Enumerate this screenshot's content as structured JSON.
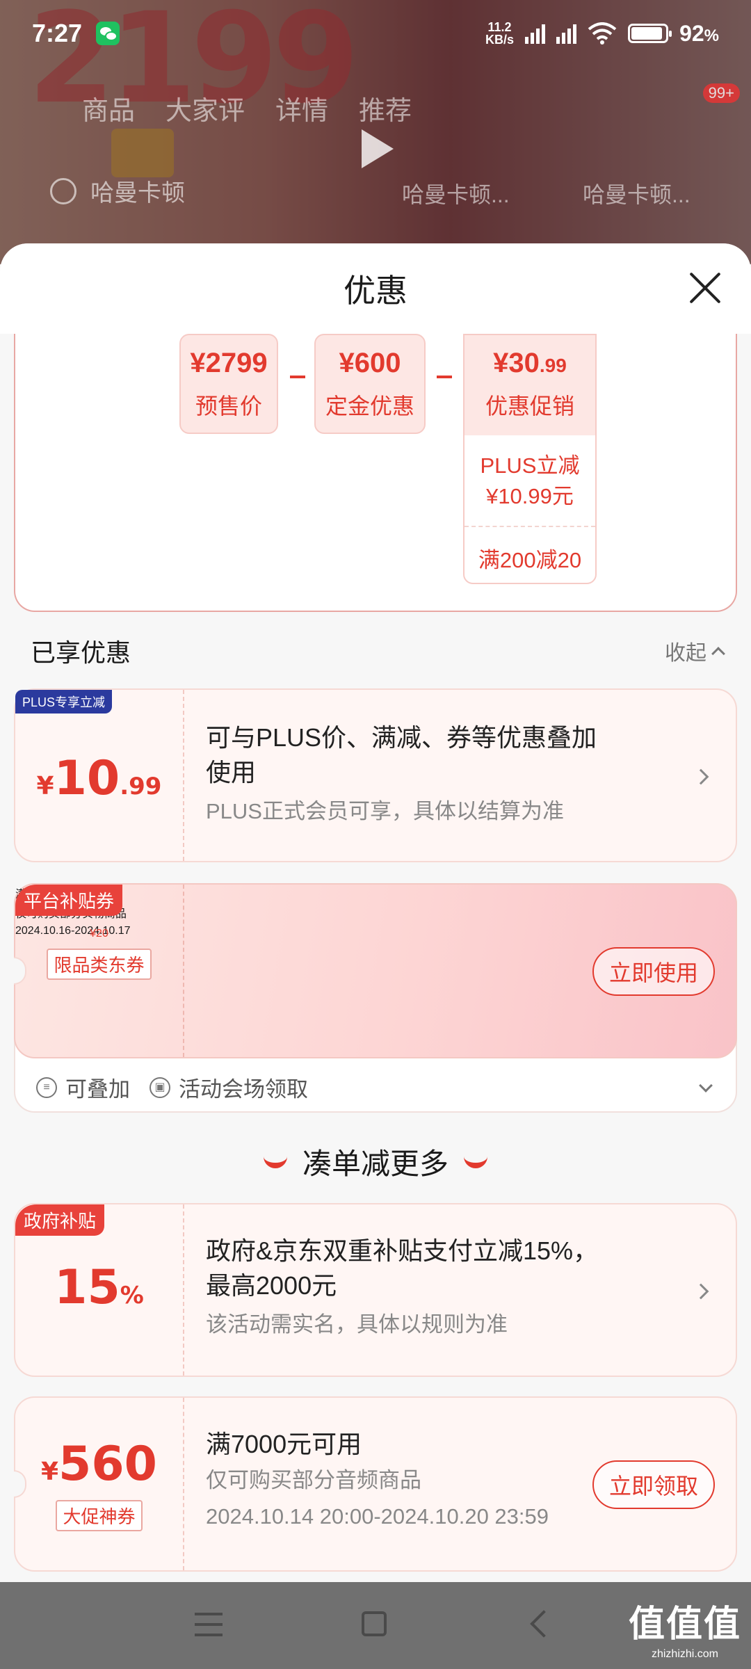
{
  "status_bar": {
    "time": "7:27",
    "net_speed_value": "11.2",
    "net_speed_unit": "KB/s",
    "battery": "92",
    "battery_unit": "%"
  },
  "background": {
    "big_price": "2199",
    "tabs": [
      "商品",
      "大家评",
      "详情",
      "推荐"
    ],
    "badge": "99+",
    "search_text": "哈曼卡顿",
    "suggestions": [
      "哈曼卡顿...",
      "哈曼卡顿..."
    ]
  },
  "sheet": {
    "title": "优惠",
    "breakdown": {
      "presale_price": "¥2799",
      "presale_label": "预售价",
      "deposit_amount": "¥600",
      "deposit_label": "定金优惠",
      "promo_amount_int": "¥30",
      "promo_amount_dec": ".99",
      "promo_label": "优惠促销",
      "plus_line1": "PLUS立减",
      "plus_line2": "¥10.99元",
      "full_reduction": "满200减20"
    },
    "enjoyed_title": "已享优惠",
    "collapse_label": "收起",
    "plus_card": {
      "badge": "PLUS专享立减",
      "yen": "¥",
      "int": "10",
      "dec": ".99",
      "title_line1": "可与PLUS价、满减、券等优惠叠加",
      "title_line2": "使用",
      "sub": "PLUS正式会员可享，具体以结算为准"
    },
    "platform_coupon": {
      "badge": "平台补贴券",
      "yen": "¥",
      "int": "20",
      "tag": "限品类东券",
      "title": "满200元可用",
      "sub": "仅可购买部分实物商品",
      "date": "2024.10.16-2024.10.17",
      "button": "立即使用",
      "stackable": "可叠加",
      "source": "活动会场领取"
    },
    "more_title": "凑单减更多",
    "gov_card": {
      "badge": "政府补贴",
      "int": "15",
      "unit": "%",
      "title_line1": "政府&京东双重补贴支付立减15%，",
      "title_line2": "最高2000元",
      "sub": "该活动需实名，具体以规则为准"
    },
    "big_coupon": {
      "yen": "¥",
      "int": "560",
      "tag": "大促神券",
      "title": "满7000元可用",
      "sub": "仅可购买部分音频商品",
      "date": "2024.10.14 20:00-2024.10.20 23:59",
      "button": "立即领取"
    }
  },
  "watermark": {
    "big": "值值值",
    "small": "zhizhizhi.com"
  },
  "colors": {
    "accent_red": "#e23a2e",
    "plus_badge": "#2b3a9e"
  }
}
